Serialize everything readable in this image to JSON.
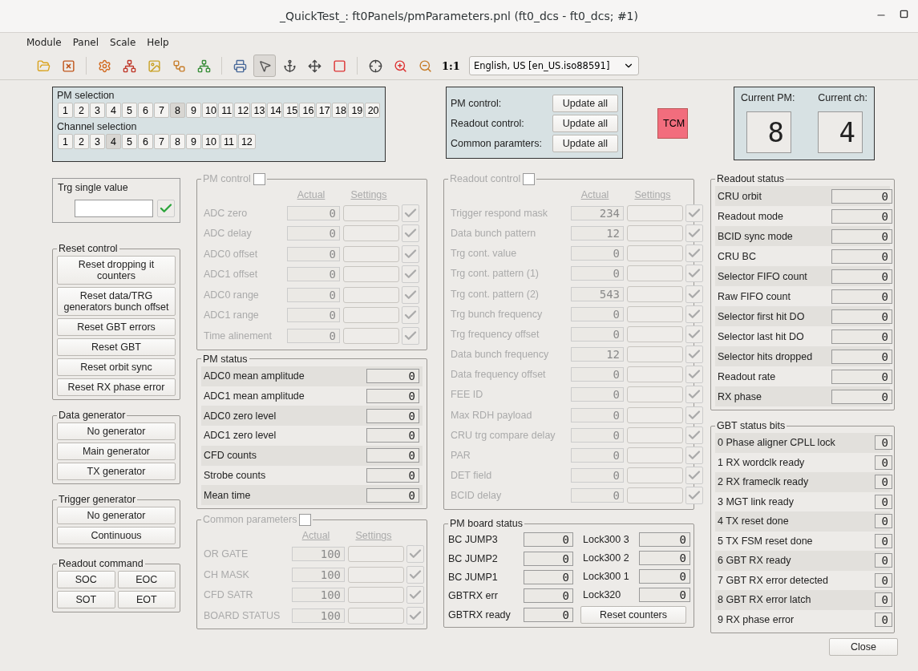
{
  "window": {
    "title": "_QuickTest_: ft0Panels/pmParameters.pnl (ft0_dcs - ft0_dcs; #1)"
  },
  "menu": [
    "Module",
    "Panel",
    "Scale",
    "Help"
  ],
  "toolbar": {
    "zoom_label": "1:1",
    "language": "English, US [en_US.iso88591]"
  },
  "pm_selection": {
    "title": "PM selection",
    "buttons": [
      {
        "label": "1",
        "selected": false
      },
      {
        "label": "2",
        "selected": false
      },
      {
        "label": "3",
        "selected": false
      },
      {
        "label": "4",
        "selected": false
      },
      {
        "label": "5",
        "selected": false
      },
      {
        "label": "6",
        "selected": false
      },
      {
        "label": "7",
        "selected": false
      },
      {
        "label": "8",
        "selected": true
      },
      {
        "label": "9",
        "selected": false
      },
      {
        "label": "10",
        "selected": false
      },
      {
        "label": "11",
        "selected": false
      },
      {
        "label": "12",
        "selected": false
      },
      {
        "label": "13",
        "selected": false
      },
      {
        "label": "14",
        "selected": false
      },
      {
        "label": "15",
        "selected": false
      },
      {
        "label": "16",
        "selected": false
      },
      {
        "label": "17",
        "selected": false
      },
      {
        "label": "18",
        "selected": false
      },
      {
        "label": "19",
        "selected": false
      },
      {
        "label": "20",
        "selected": false
      }
    ]
  },
  "channel_selection": {
    "title": "Channel selection",
    "buttons": [
      {
        "label": "1",
        "selected": false
      },
      {
        "label": "2",
        "selected": false
      },
      {
        "label": "3",
        "selected": false
      },
      {
        "label": "4",
        "selected": true
      },
      {
        "label": "5",
        "selected": false
      },
      {
        "label": "6",
        "selected": false
      },
      {
        "label": "7",
        "selected": false
      },
      {
        "label": "8",
        "selected": false
      },
      {
        "label": "9",
        "selected": false
      },
      {
        "label": "10",
        "selected": false
      },
      {
        "label": "11",
        "selected": false
      },
      {
        "label": "12",
        "selected": false
      }
    ]
  },
  "update_panel": {
    "rows": [
      {
        "label": "PM control:",
        "button": "Update all"
      },
      {
        "label": "Readout control:",
        "button": "Update all"
      },
      {
        "label": "Common paramters:",
        "button": "Update all"
      }
    ],
    "tcm": "TCM"
  },
  "current": {
    "pm_label": "Current PM:",
    "pm_value": "8",
    "ch_label": "Current ch:",
    "ch_value": "4"
  },
  "trg_single_value": {
    "title": "Trg single value"
  },
  "reset_control": {
    "title": "Reset control",
    "buttons": [
      "Reset dropping it counters",
      "Reset data/TRG generators bunch offset",
      "Reset GBT errors",
      "Reset GBT",
      "Reset orbit sync",
      "Reset RX phase error"
    ]
  },
  "data_generator": {
    "title": "Data generator",
    "buttons": [
      "No generator",
      "Main generator",
      "TX generator"
    ]
  },
  "trigger_generator": {
    "title": "Trigger generator",
    "buttons": [
      "No generator",
      "Continuous"
    ]
  },
  "readout_command": {
    "title": "Readout command",
    "buttons": [
      "SOC",
      "EOC",
      "SOT",
      "EOT"
    ]
  },
  "pm_control": {
    "title": "PM control",
    "enabled": false,
    "checked": false,
    "actual_header": "Actual",
    "settings_header": "Settings",
    "rows": [
      {
        "label": "ADC zero",
        "actual": "0"
      },
      {
        "label": "ADC delay",
        "actual": "0"
      },
      {
        "label": "ADC0 offset",
        "actual": "0"
      },
      {
        "label": "ADC1 offset",
        "actual": "0"
      },
      {
        "label": "ADC0 range",
        "actual": "0"
      },
      {
        "label": "ADC1 range",
        "actual": "0"
      },
      {
        "label": "Time alinement",
        "actual": "0"
      }
    ]
  },
  "pm_status": {
    "title": "PM status",
    "rows": [
      {
        "label": "ADC0 mean amplitude",
        "value": "0"
      },
      {
        "label": "ADC1 mean amplitude",
        "value": "0"
      },
      {
        "label": "ADC0 zero level",
        "value": "0"
      },
      {
        "label": "ADC1 zero level",
        "value": "0"
      },
      {
        "label": "CFD counts",
        "value": "0"
      },
      {
        "label": "Strobe counts",
        "value": "0"
      },
      {
        "label": "Mean time",
        "value": "0"
      }
    ]
  },
  "common_parameters": {
    "title": "Common parameters",
    "enabled": false,
    "checked": false,
    "actual_header": "Actual",
    "settings_header": "Settings",
    "rows": [
      {
        "label": "OR GATE",
        "actual": "100"
      },
      {
        "label": "CH MASK",
        "actual": "100"
      },
      {
        "label": "CFD SATR",
        "actual": "100"
      },
      {
        "label": "BOARD STATUS",
        "actual": "100"
      }
    ]
  },
  "readout_control": {
    "title": "Readout control",
    "enabled": false,
    "checked": false,
    "actual_header": "Actual",
    "settings_header": "Settings",
    "rows": [
      {
        "label": "Trigger respond mask",
        "actual": "234"
      },
      {
        "label": "Data bunch pattern",
        "actual": "12"
      },
      {
        "label": "Trg cont. value",
        "actual": "0"
      },
      {
        "label": "Trg cont. pattern (1)",
        "actual": "0"
      },
      {
        "label": "Trg cont. pattern (2)",
        "actual": "543"
      },
      {
        "label": "Trg bunch frequency",
        "actual": "0"
      },
      {
        "label": "Trg frequency offset",
        "actual": "0"
      },
      {
        "label": "Data bunch frequency",
        "actual": "12"
      },
      {
        "label": "Data frequency offset",
        "actual": "0"
      },
      {
        "label": "FEE ID",
        "actual": "0"
      },
      {
        "label": "Max RDH payload",
        "actual": "0"
      },
      {
        "label": "CRU trg compare delay",
        "actual": "0"
      },
      {
        "label": "PAR",
        "actual": "0"
      },
      {
        "label": "DET field",
        "actual": "0"
      },
      {
        "label": "BCID delay",
        "actual": "0"
      }
    ]
  },
  "pm_board_status": {
    "title": "PM board status",
    "left": [
      {
        "label": "BC JUMP3",
        "value": "0"
      },
      {
        "label": "BC JUMP2",
        "value": "0"
      },
      {
        "label": "BC JUMP1",
        "value": "0"
      },
      {
        "label": "GBTRX err",
        "value": "0"
      },
      {
        "label": "GBTRX ready",
        "value": "0"
      }
    ],
    "right": [
      {
        "label": "Lock300 3",
        "value": "0"
      },
      {
        "label": "Lock300 2",
        "value": "0"
      },
      {
        "label": "Lock300 1",
        "value": "0"
      },
      {
        "label": "Lock320",
        "value": "0"
      }
    ],
    "button": "Reset counters"
  },
  "readout_status": {
    "title": "Readout status",
    "rows": [
      {
        "label": "CRU orbit",
        "value": "0"
      },
      {
        "label": "Readout mode",
        "value": "0"
      },
      {
        "label": "BCID sync mode",
        "value": "0"
      },
      {
        "label": "CRU BC",
        "value": "0"
      },
      {
        "label": "Selector FIFO count",
        "value": "0"
      },
      {
        "label": "Raw FIFO count",
        "value": "0"
      },
      {
        "label": "Selector first hit DO",
        "value": "0"
      },
      {
        "label": "Selector last hit DO",
        "value": "0"
      },
      {
        "label": "Selector hits dropped",
        "value": "0"
      },
      {
        "label": "Readout rate",
        "value": "0"
      },
      {
        "label": "RX phase",
        "value": "0"
      }
    ]
  },
  "gbt_status_bits": {
    "title": "GBT status bits",
    "rows": [
      {
        "label": "0 Phase aligner CPLL lock",
        "value": "0"
      },
      {
        "label": "1 RX wordclk ready",
        "value": "0"
      },
      {
        "label": "2 RX frameclk ready",
        "value": "0"
      },
      {
        "label": "3 MGT link ready",
        "value": "0"
      },
      {
        "label": "4 TX reset done",
        "value": "0"
      },
      {
        "label": "5 TX FSM reset done",
        "value": "0"
      },
      {
        "label": "6 GBT RX ready",
        "value": "0"
      },
      {
        "label": "7 GBT RX error detected",
        "value": "0"
      },
      {
        "label": "8 GBT RX error latch",
        "value": "0"
      },
      {
        "label": "9 RX phase error",
        "value": "0"
      }
    ]
  },
  "close_button": "Close"
}
